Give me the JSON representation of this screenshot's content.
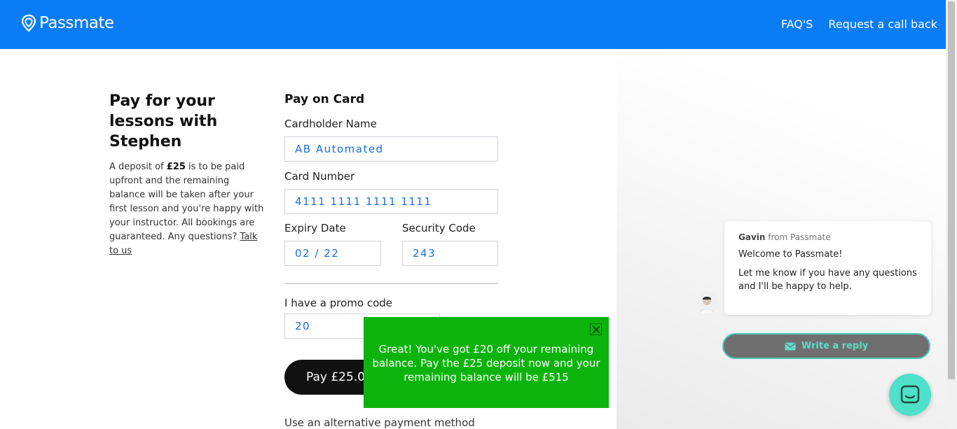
{
  "header": {
    "brand": "Passmate",
    "nav": [
      {
        "label": "FAQ'S"
      },
      {
        "label": "Request a call back"
      }
    ]
  },
  "intro": {
    "title": "Pay for your lessons with Stephen",
    "text_before": "A deposit of ",
    "deposit": "£25",
    "text_after": " is to be paid upfront and the remaining balance will be taken after your first lesson and you're happy with your instructor. All bookings are guaranteed. Any questions? ",
    "link": "Talk to us"
  },
  "form": {
    "title": "Pay on Card",
    "cardholder_label": "Cardholder Name",
    "cardholder_value": "AB Automated",
    "card_number_label": "Card Number",
    "card_number_value": "4111 1111 1111 1111",
    "expiry_label": "Expiry Date",
    "expiry_value": "02 / 22",
    "security_label": "Security Code",
    "security_value": "243",
    "promo_label": "I have a promo code",
    "promo_value": "20",
    "pay_button": "Pay £25.00",
    "alt_payment": "Use an alternative payment method"
  },
  "toast": {
    "message": "Great! You've got £20 off your remaining balance. Pay the £25 deposit now and your remaining balance will be £515"
  },
  "chat": {
    "agent": "Gavin",
    "from_suffix": " from Passmate",
    "welcome": "Welcome to Passmate!",
    "body": "Let me know if you have any questions and I'll be happy to help.",
    "reply_button": "Write a reply"
  },
  "colors": {
    "header": "#0a7cf5",
    "toast": "#0db30d",
    "launcher": "#4ee0c8",
    "input_text": "#1a6fd8"
  },
  "icons": {
    "logo": "pin-logo-icon",
    "close": "close-icon",
    "reply": "envelope-icon",
    "launcher": "chat-bubble-icon"
  }
}
